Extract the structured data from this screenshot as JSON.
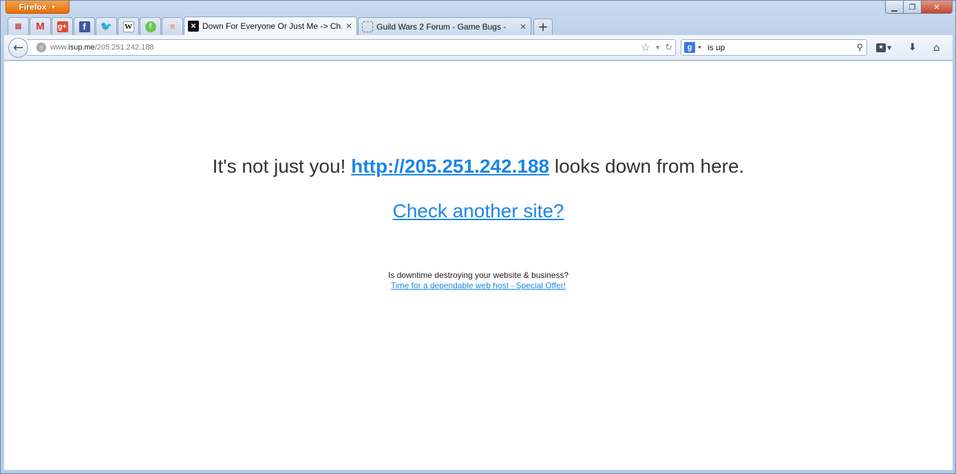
{
  "browser": {
    "app_button": "Firefox",
    "tabs": {
      "active": {
        "title": "Down For Everyone Or Just Me -> Ch..."
      },
      "other": {
        "title": "Guild Wars 2 Forum - Game Bugs -"
      }
    },
    "pinned_tab_icons": [
      "feed-icon",
      "gmail-icon",
      "google-plus-icon",
      "facebook-icon",
      "twitter-icon",
      "wikipedia-icon",
      "feedly-icon",
      "stackoverflow-icon"
    ],
    "url": {
      "prefix": "www.",
      "host": "isup.me",
      "path": "/205.251.242.188"
    },
    "search": {
      "engine": "Google",
      "value": "is up"
    }
  },
  "page": {
    "headline_pre": "It's not just you!",
    "headline_link": "http://205.251.242.188",
    "headline_post": "looks down from here.",
    "check_link": "Check another site?",
    "ad_text": "Is downtime destroying your website & business?",
    "ad_link": "Time for a dependable web host - Special Offer!"
  },
  "colors": {
    "link": "#1b86e6",
    "text": "#333333",
    "firefox_button": "#e66f06"
  }
}
